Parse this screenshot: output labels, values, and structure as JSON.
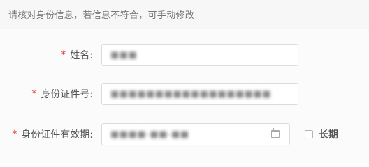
{
  "notice": {
    "text": "请核对身份信息，若信息不符合，可手动修改"
  },
  "form": {
    "required_mark": "*",
    "name": {
      "label": "姓名:",
      "value": "■■■"
    },
    "id_number": {
      "label": "身份证件号:",
      "value": "■■■■■■■■■■■■■■■■■■"
    },
    "id_validity": {
      "label": "身份证件有效期:",
      "value": "■■■■-■■-■■",
      "icon": "calendar-icon"
    },
    "long_term": {
      "label": "长期",
      "checked": false
    }
  },
  "colors": {
    "required": "#e4393c",
    "notice_background": "#f7f7f7",
    "input_border": "#dcdcdc"
  }
}
